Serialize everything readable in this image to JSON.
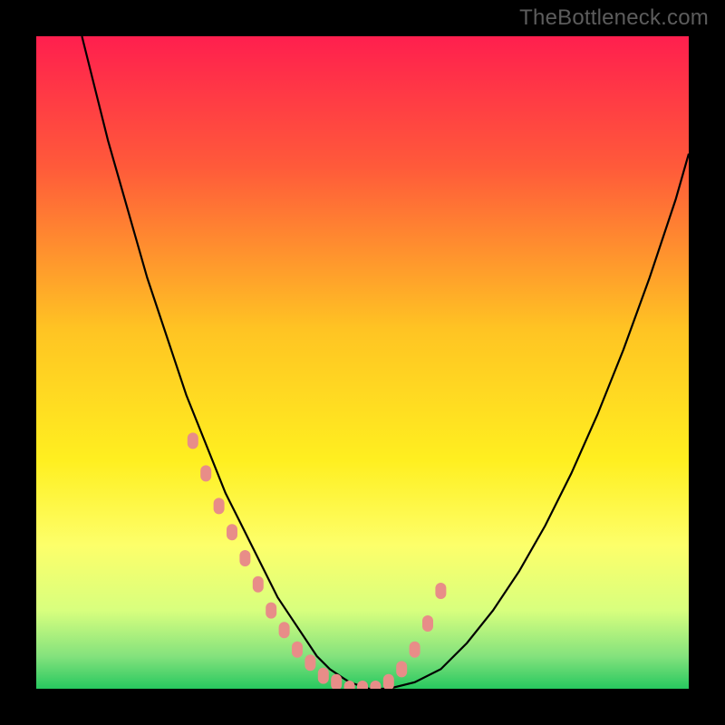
{
  "watermark": "TheBottleneck.com",
  "chart_data": {
    "type": "line",
    "title": "",
    "xlabel": "",
    "ylabel": "",
    "xlim": [
      0,
      100
    ],
    "ylim": [
      0,
      100
    ],
    "grid": false,
    "legend": false,
    "background_gradient": [
      {
        "pos": 0.0,
        "color": "#ff1f4e"
      },
      {
        "pos": 0.2,
        "color": "#ff5a3a"
      },
      {
        "pos": 0.45,
        "color": "#ffc423"
      },
      {
        "pos": 0.65,
        "color": "#ffef20"
      },
      {
        "pos": 0.78,
        "color": "#fdff6a"
      },
      {
        "pos": 0.88,
        "color": "#d8ff7e"
      },
      {
        "pos": 0.95,
        "color": "#84e27d"
      },
      {
        "pos": 1.0,
        "color": "#27c85f"
      }
    ],
    "series": [
      {
        "name": "bottleneck-curve",
        "color": "#000000",
        "x": [
          7,
          9,
          11,
          13,
          15,
          17,
          19,
          21,
          23,
          25,
          27,
          29,
          31,
          33,
          35,
          37,
          39,
          41,
          43,
          45,
          48,
          51,
          54,
          58,
          62,
          66,
          70,
          74,
          78,
          82,
          86,
          90,
          94,
          98,
          100
        ],
        "y": [
          100,
          92,
          84,
          77,
          70,
          63,
          57,
          51,
          45,
          40,
          35,
          30,
          26,
          22,
          18,
          14,
          11,
          8,
          5,
          3,
          1,
          0,
          0,
          1,
          3,
          7,
          12,
          18,
          25,
          33,
          42,
          52,
          63,
          75,
          82
        ]
      }
    ],
    "highlight_band": {
      "name": "optimal-zone",
      "type": "markers",
      "color": "#e88d88",
      "x": [
        24,
        26,
        28,
        30,
        32,
        34,
        36,
        38,
        40,
        42,
        44,
        46,
        48,
        50,
        52,
        54,
        56,
        58,
        60,
        62
      ],
      "y": [
        38,
        33,
        28,
        24,
        20,
        16,
        12,
        9,
        6,
        4,
        2,
        1,
        0,
        0,
        0,
        1,
        3,
        6,
        10,
        15
      ]
    }
  }
}
